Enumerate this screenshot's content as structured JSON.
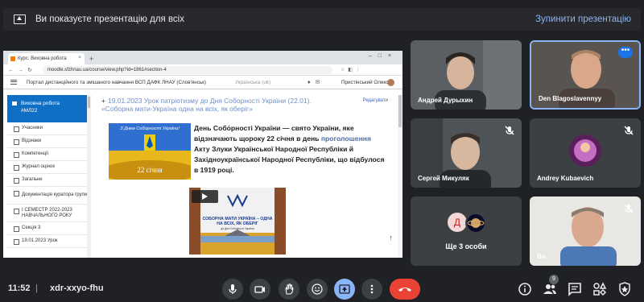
{
  "topbar": {
    "message": "Ви показуєте презентацію для всіх",
    "stop_label": "Зупинити презентацію"
  },
  "shared_screen": {
    "browser": {
      "tab_title": "Курс: Виховна робота",
      "url": "moodle.sfzhnau.ua/course/view.php?id=1861#section-4"
    },
    "site": {
      "header_title": "Портал дистанційного та змішаного навчання ВСП ДАФК ЛНАУ (Слов'янськ)",
      "language": "Українська (uk)",
      "user_name": "Пристінський Олексій"
    },
    "sidebar": {
      "active_label_line1": "Виховна робота",
      "active_label_line2": "#МЛ22",
      "items": [
        "Учасники",
        "Відзнаки",
        "Компетенції",
        "Журнал оцінок",
        "Загальне",
        "Документація куратора групи",
        "I СЕМЕСТР 2022-2023 НАВЧАЛЬНОГО РОКУ",
        "Секція 3",
        "19.01.2023 Урок"
      ]
    },
    "content": {
      "section_title": "19.01.2023 Урок патріотизму до Дня Соборності України (22.01). «Соборна мати-Україна одна на всіх, як оберіг»",
      "edit_label": "Редагувати",
      "banner1_text": "З Днем Соборності України!",
      "banner1_date": "22 січня",
      "paragraph_part1": "День Собо́рності України — свято України, яке відзначають щороку 22 січня в день ",
      "paragraph_highlight": "проголошення",
      "paragraph_part2": " Акту Злуки Української Народної Республіки й Західноукраїнської Народної Республіки, що відбулося в 1919 році.",
      "banner2_title": "СОБОРНА МАТИ УКРАЇНА – ОДНА НА ВСІХ, ЯК ОБЕРІГ",
      "banner2_sub": "до Дня Соборності України"
    }
  },
  "participants": [
    {
      "name": "Андрей Дурыхин",
      "muted": false
    },
    {
      "name": "Den Blagoslavennyy",
      "muted": false
    },
    {
      "name": "Сергей Микуляк",
      "muted": true
    },
    {
      "name": "Andrey Kubaevich",
      "muted": true
    },
    {
      "name": "Ви",
      "muted": true
    }
  ],
  "others": {
    "label": "Ще 3 особи",
    "avatar_letter": "Д"
  },
  "bottombar": {
    "time": "11:52",
    "separator": "|",
    "meeting_code": "xdr-xxyo-fhu",
    "people_count": "9"
  },
  "colors": {
    "background": "#202124",
    "tile": "#3c4043",
    "accent": "#8ab4f8",
    "leave": "#ea4335",
    "moodle_blue": "#0f6fc5"
  }
}
